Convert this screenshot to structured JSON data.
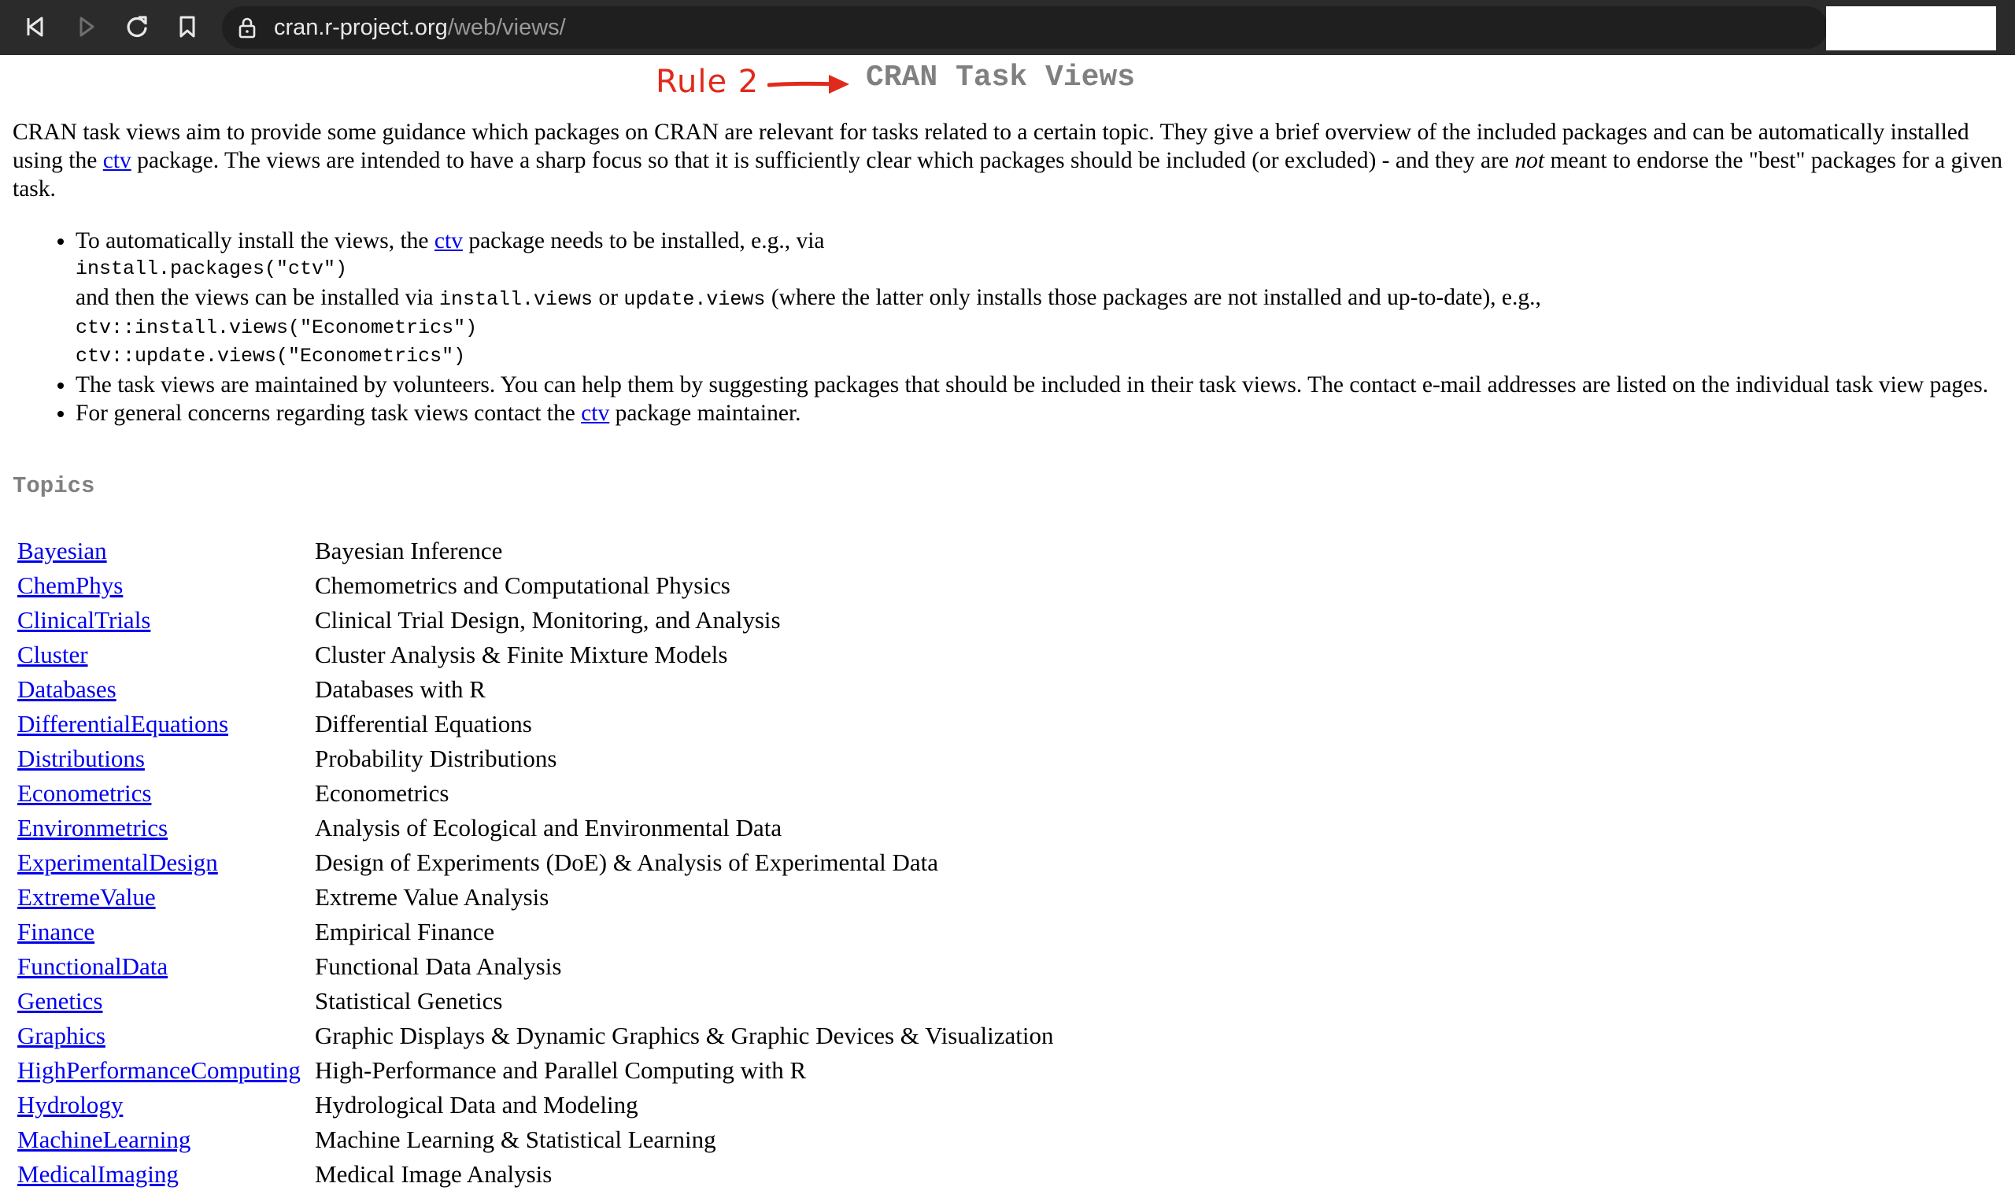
{
  "browser": {
    "url_host": "cran.r-project.org",
    "url_path": "/web/views/"
  },
  "annotation": {
    "text": "Rule 2",
    "color": "#e02a1c"
  },
  "page": {
    "title": "CRAN Task Views",
    "intro": {
      "part1": "CRAN task views aim to provide some guidance which packages on CRAN are relevant for tasks related to a certain topic. They give a brief overview of the included packages and can be automatically installed using the ",
      "link": "ctv",
      "part2": " package. The views are intended to have a sharp focus so that it is sufficiently clear which packages should be included (or excluded) - and they are ",
      "emphasis": "not",
      "part3": " meant to endorse the \"best\" packages for a given task."
    },
    "bullet1": {
      "text1": "To automatically install the views, the ",
      "link": "ctv",
      "text2": " package needs to be installed, e.g., via",
      "code1": "install.packages(\"ctv\")",
      "text3": "and then the views can be installed via ",
      "code_install": "install.views",
      "text4": " or ",
      "code_update": "update.views",
      "text5": " (where the latter only installs those packages are not installed and up-to-date), e.g.,",
      "code2": "ctv::install.views(\"Econometrics\")",
      "code3": "ctv::update.views(\"Econometrics\")"
    },
    "bullet2": {
      "text": "The task views are maintained by volunteers. You can help them by suggesting packages that should be included in their task views. The contact e-mail addresses are listed on the individual task view pages."
    },
    "bullet3": {
      "text1": "For general concerns regarding task views contact the ",
      "link": "ctv",
      "text2": " package maintainer."
    },
    "topics_heading": "Topics",
    "topics": [
      {
        "name": "Bayesian",
        "description": "Bayesian Inference"
      },
      {
        "name": "ChemPhys",
        "description": "Chemometrics and Computational Physics"
      },
      {
        "name": "ClinicalTrials",
        "description": "Clinical Trial Design, Monitoring, and Analysis"
      },
      {
        "name": "Cluster",
        "description": "Cluster Analysis & Finite Mixture Models"
      },
      {
        "name": "Databases",
        "description": "Databases with R"
      },
      {
        "name": "DifferentialEquations",
        "description": "Differential Equations"
      },
      {
        "name": "Distributions",
        "description": "Probability Distributions"
      },
      {
        "name": "Econometrics",
        "description": "Econometrics"
      },
      {
        "name": "Environmetrics",
        "description": "Analysis of Ecological and Environmental Data"
      },
      {
        "name": "ExperimentalDesign",
        "description": "Design of Experiments (DoE) & Analysis of Experimental Data"
      },
      {
        "name": "ExtremeValue",
        "description": "Extreme Value Analysis"
      },
      {
        "name": "Finance",
        "description": "Empirical Finance"
      },
      {
        "name": "FunctionalData",
        "description": "Functional Data Analysis"
      },
      {
        "name": "Genetics",
        "description": "Statistical Genetics"
      },
      {
        "name": "Graphics",
        "description": "Graphic Displays & Dynamic Graphics & Graphic Devices & Visualization"
      },
      {
        "name": "HighPerformanceComputing",
        "description": "High-Performance and Parallel Computing with R"
      },
      {
        "name": "Hydrology",
        "description": "Hydrological Data and Modeling"
      },
      {
        "name": "MachineLearning",
        "description": "Machine Learning & Statistical Learning"
      },
      {
        "name": "MedicalImaging",
        "description": "Medical Image Analysis"
      }
    ]
  }
}
